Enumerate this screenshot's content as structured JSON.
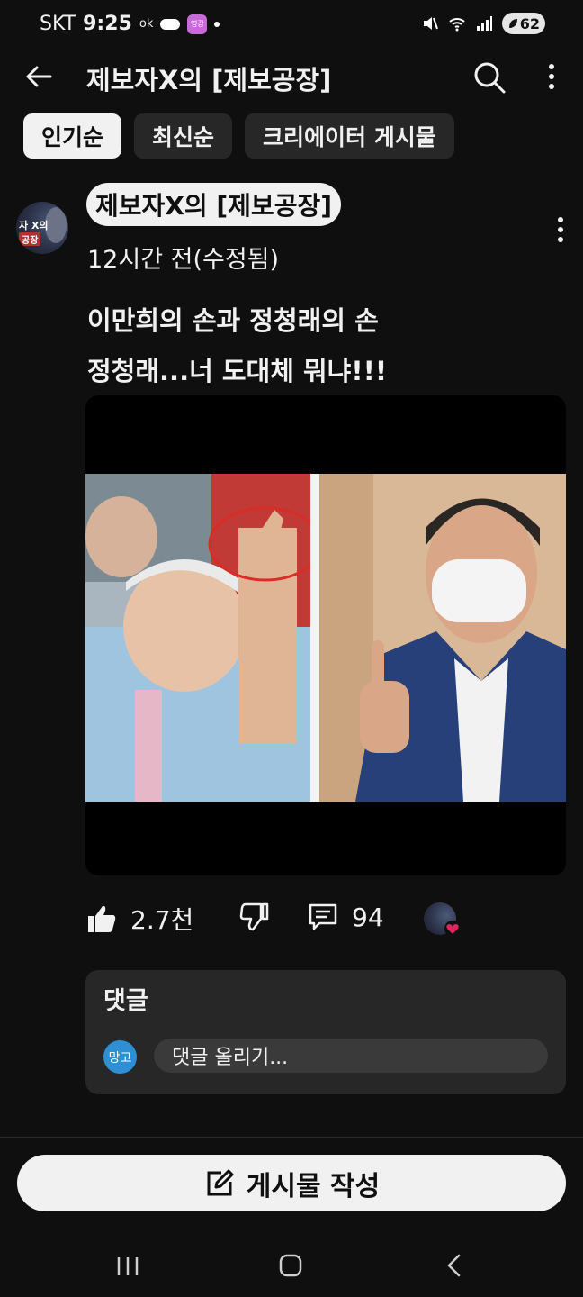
{
  "status_bar": {
    "carrier": "SKT",
    "time": "9:25",
    "ok_label": "ok",
    "app_badge": "영감",
    "battery": "62"
  },
  "header": {
    "title": "제보자X의 [제보공장]"
  },
  "filter_chips": [
    {
      "label": "인기순",
      "active": true
    },
    {
      "label": "최신순",
      "active": false
    },
    {
      "label": "크리에이터 게시물",
      "active": false
    }
  ],
  "post": {
    "channel_name": "제보자X의 [제보공장]",
    "avatar_text_top": "자 X의",
    "avatar_text_bottom": "공장",
    "time": "12시간 전(수정됨)",
    "text_lines": [
      "이만희의 손과 정청래의 손",
      "정청래...너 도대체 뭐냐!!!"
    ]
  },
  "actions": {
    "likes": "2.7천",
    "comments": "94"
  },
  "comments_panel": {
    "title": "댓글",
    "my_avatar": "망고",
    "placeholder": "댓글 올리기..."
  },
  "write_button": {
    "label": "게시물 작성"
  },
  "colors": {
    "background": "#0f0f0f",
    "surface": "#272727",
    "text": "#f1f1f1",
    "accent_blue": "#2d8fd5",
    "heart_red": "#e0245e"
  }
}
